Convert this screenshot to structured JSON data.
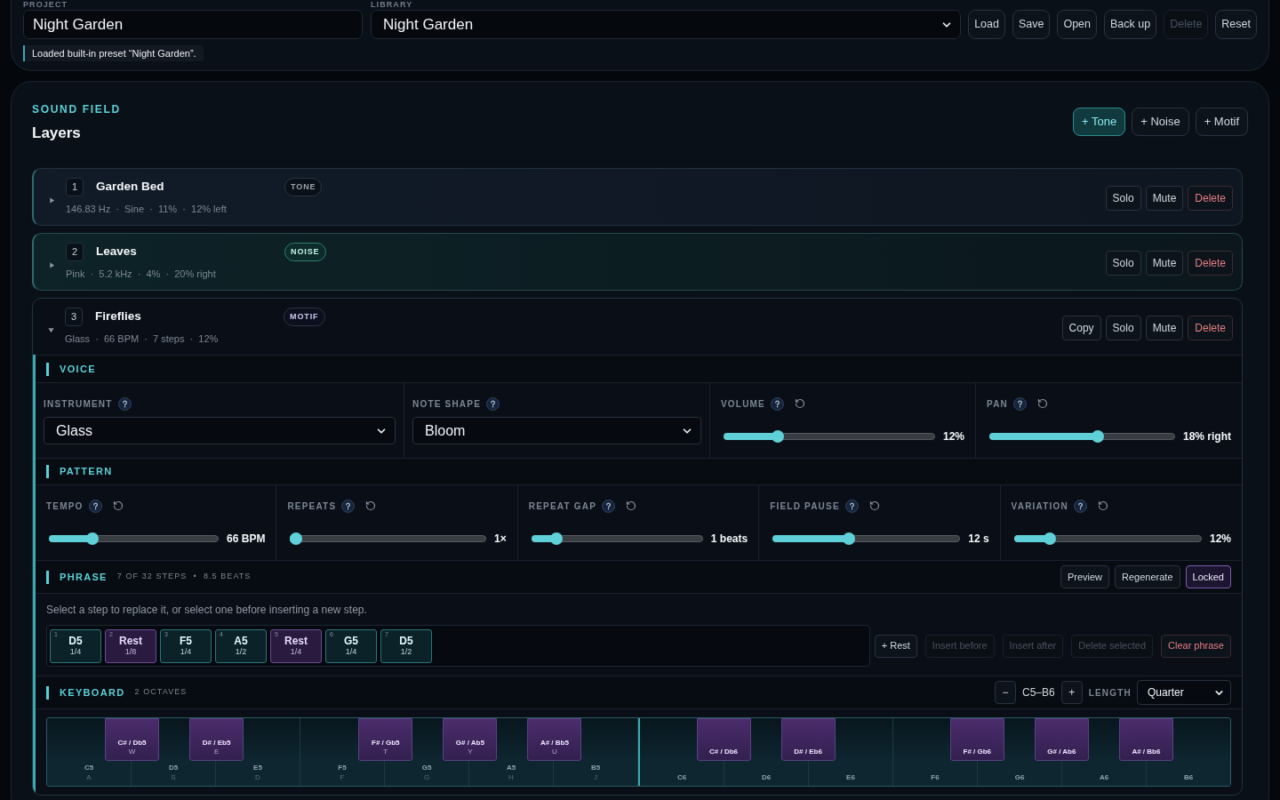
{
  "project": {
    "label": "PROJECT",
    "value": "Night Garden"
  },
  "library": {
    "label": "LIBRARY",
    "value": "Night Garden"
  },
  "actions": [
    {
      "label": "Load",
      "disabled": false
    },
    {
      "label": "Save",
      "disabled": false
    },
    {
      "label": "Open",
      "disabled": false
    },
    {
      "label": "Back up",
      "disabled": false
    },
    {
      "label": "Delete",
      "disabled": true
    },
    {
      "label": "Reset",
      "disabled": false
    }
  ],
  "status": "Loaded built-in preset “Night Garden”.",
  "sound_field": {
    "eyebrow": "SOUND FIELD",
    "title": "Layers",
    "add_buttons": [
      {
        "label": "+ Tone",
        "selected": true
      },
      {
        "label": "+ Noise",
        "selected": false
      },
      {
        "label": "+ Motif",
        "selected": false
      }
    ]
  },
  "layers": [
    {
      "number": "1",
      "name": "Garden Bed",
      "kind": "tone",
      "badge": "TONE",
      "summary": "146.83 Hz  ·  Sine  ·  11%  ·  12% left",
      "expanded": false,
      "selected": false,
      "buttons": [
        {
          "label": "Solo",
          "kind": "plain"
        },
        {
          "label": "Mute",
          "kind": "plain"
        },
        {
          "label": "Delete",
          "kind": "danger"
        }
      ]
    },
    {
      "number": "2",
      "name": "Leaves",
      "kind": "noise",
      "badge": "NOISE",
      "summary": "Pink  ·  5.2 kHz  ·  4%  ·  20% right",
      "expanded": false,
      "selected": true,
      "buttons": [
        {
          "label": "Solo",
          "kind": "plain"
        },
        {
          "label": "Mute",
          "kind": "plain"
        },
        {
          "label": "Delete",
          "kind": "danger"
        }
      ]
    },
    {
      "number": "3",
      "name": "Fireflies",
      "kind": "motif",
      "badge": "MOTIF",
      "summary": "Glass  ·  66 BPM  ·  7 steps  ·  12%",
      "expanded": true,
      "selected": false,
      "buttons": [
        {
          "label": "Copy",
          "kind": "plain"
        },
        {
          "label": "Solo",
          "kind": "plain"
        },
        {
          "label": "Mute",
          "kind": "plain"
        },
        {
          "label": "Delete",
          "kind": "danger"
        }
      ],
      "editor": {
        "voice": {
          "title": "VOICE",
          "fields": [
            {
              "kind": "select",
              "label": "INSTRUMENT",
              "value": "Glass"
            },
            {
              "kind": "select",
              "label": "NOTE SHAPE",
              "value": "Bloom"
            },
            {
              "kind": "slider",
              "label": "VOLUME",
              "level": 0.24,
              "reading": "12%"
            },
            {
              "kind": "slider",
              "label": "PAN",
              "level": 0.59,
              "reading": "18% right"
            }
          ]
        },
        "pattern": {
          "title": "PATTERN",
          "fields": [
            {
              "kind": "slider",
              "label": "TEMPO",
              "level": 0.24,
              "reading": "66 BPM"
            },
            {
              "kind": "slider",
              "label": "REPEATS",
              "level": 0,
              "reading": "1×"
            },
            {
              "kind": "slider",
              "label": "REPEAT GAP",
              "level": 0.12,
              "reading": "1 beats"
            },
            {
              "kind": "slider",
              "label": "FIELD PAUSE",
              "level": 0.4,
              "reading": "12 s"
            },
            {
              "kind": "slider",
              "label": "VARIATION",
              "level": 0.17,
              "reading": "12%"
            }
          ]
        },
        "phrase": {
          "title": "PHRASE",
          "meta": "7 OF 32 STEPS  •  8.5 BEATS",
          "buttons": [
            {
              "label": "Preview",
              "pressed": false
            },
            {
              "label": "Regenerate",
              "pressed": false
            },
            {
              "label": "Locked",
              "pressed": true
            }
          ],
          "hint": "Select a step to replace it, or select one before inserting a new step.",
          "steps": [
            {
              "index": "1",
              "note": "D5",
              "length": "1/4",
              "kind": "note"
            },
            {
              "index": "2",
              "note": "Rest",
              "length": "1/8",
              "kind": "rest"
            },
            {
              "index": "3",
              "note": "F5",
              "length": "1/4",
              "kind": "note"
            },
            {
              "index": "4",
              "note": "A5",
              "length": "1/2",
              "kind": "note"
            },
            {
              "index": "5",
              "note": "Rest",
              "length": "1/4",
              "kind": "rest"
            },
            {
              "index": "6",
              "note": "G5",
              "length": "1/4",
              "kind": "note"
            },
            {
              "index": "7",
              "note": "D5",
              "length": "1/2",
              "kind": "note"
            }
          ],
          "actions": [
            {
              "label": "+ Rest",
              "disabled": false,
              "kind": "plain"
            },
            {
              "label": "Insert before",
              "disabled": true,
              "kind": "plain"
            },
            {
              "label": "Insert after",
              "disabled": true,
              "kind": "plain"
            },
            {
              "label": "Delete selected",
              "disabled": true,
              "kind": "plain"
            },
            {
              "label": "Clear phrase",
              "disabled": false,
              "kind": "danger"
            }
          ]
        },
        "keyboard": {
          "title": "KEYBOARD",
          "meta": "2 OCTAVES",
          "decrease": "−",
          "range": "C5–B6",
          "increase": "+",
          "length_label": "LENGTH",
          "length": "Quarter",
          "white_keys": [
            {
              "note": "C5",
              "key": "A"
            },
            {
              "note": "D5",
              "key": "S"
            },
            {
              "note": "E5",
              "key": "D"
            },
            {
              "note": "F5",
              "key": "F"
            },
            {
              "note": "G5",
              "key": "G"
            },
            {
              "note": "A5",
              "key": "H"
            },
            {
              "note": "B5",
              "key": "J"
            },
            {
              "note": "C6"
            },
            {
              "note": "D6"
            },
            {
              "note": "E6"
            },
            {
              "note": "F6"
            },
            {
              "note": "G6"
            },
            {
              "note": "A6"
            },
            {
              "note": "B6"
            }
          ],
          "black_keys": [
            {
              "note": "C# / Db5",
              "key": "W"
            },
            {
              "note": "D# / Eb5",
              "key": "E"
            },
            {
              "note": "F# / Gb5",
              "key": "T"
            },
            {
              "note": "G# / Ab5",
              "key": "Y"
            },
            {
              "note": "A# / Bb5",
              "key": "U"
            },
            {
              "note": "C# / Db6"
            },
            {
              "note": "D# / Eb6"
            },
            {
              "note": "F# / Gb6"
            },
            {
              "note": "G# / Ab6"
            },
            {
              "note": "A# / Bb6"
            }
          ]
        }
      }
    }
  ]
}
